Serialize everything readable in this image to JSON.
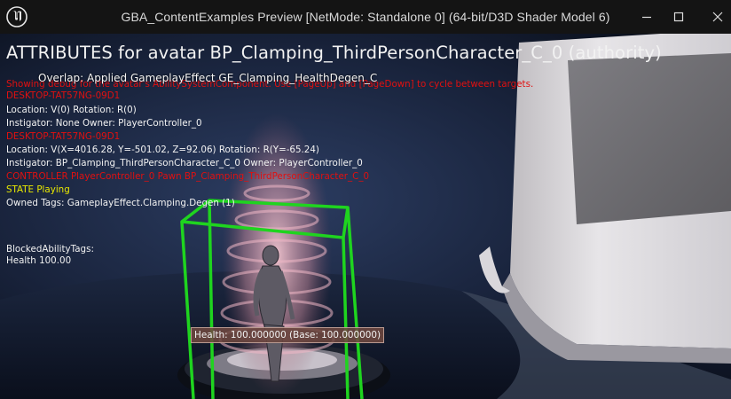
{
  "window": {
    "title": "GBA_ContentExamples Preview [NetMode: Standalone 0]  (64-bit/D3D Shader Model 6)",
    "controls": [
      "minimize-icon",
      "maximize-icon",
      "close-icon"
    ]
  },
  "hud": {
    "header": "ATTRIBUTES for avatar BP_Clamping_ThirdPersonCharacter_C_0 (authority)",
    "overlap_message": "Overlap: Applied GameplayEffect GE_Clamping_HealthDegen_C",
    "lines": [
      {
        "text": "Showing debug for the avatar's AbilitySystemComponent. Use [PageUp] and [PageDown] to cycle between targets.",
        "color": "#e11010"
      },
      {
        "text": "DESKTOP-TAT57NG-09D1",
        "color": "#e11010"
      },
      {
        "text": "Location: V(0) Rotation: R(0)",
        "color": "#f2f2f2"
      },
      {
        "text": " Instigator: None Owner: PlayerController_0",
        "color": "#f2f2f2"
      },
      {
        "text": "DESKTOP-TAT57NG-09D1",
        "color": "#e11010"
      },
      {
        "text": "Location: V(X=4016.28, Y=-501.02, Z=92.06) Rotation: R(Y=-65.24)",
        "color": "#f2f2f2"
      },
      {
        "text": " Instigator: BP_Clamping_ThirdPersonCharacter_C_0 Owner: PlayerController_0",
        "color": "#f2f2f2"
      },
      {
        "text": "CONTROLLER PlayerController_0 Pawn BP_Clamping_ThirdPersonCharacter_C_0",
        "color": "#e11010"
      },
      {
        "text": "STATE Playing",
        "color": "#e8e800"
      },
      {
        "text": "Owned Tags: GameplayEffect.Clamping.Degen (1)",
        "color": "#f2f2f2"
      },
      {
        "text": "BlockedAbilityTags:",
        "color": "#f2f2f2"
      },
      {
        "text": "Health 100.00",
        "color": "#f2f2f2"
      }
    ],
    "health_label": "Health: 100.000000 (Base: 100.000000)"
  },
  "colors": {
    "titlebar_bg": "#141414",
    "debug_red": "#e11010",
    "debug_yellow": "#e8e800",
    "debug_box_green": "#1fd41f"
  }
}
